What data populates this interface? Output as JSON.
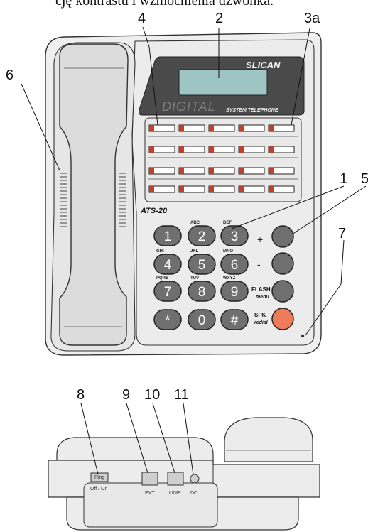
{
  "header_text": "cję kontrastu i wzmocnienia dzwonka.",
  "callouts": {
    "c1": "1",
    "c2": "2",
    "c3a": "3a",
    "c4": "4",
    "c5": "5",
    "c6": "6",
    "c7": "7",
    "c8": "8",
    "c9": "9",
    "c10": "10",
    "c11": "11"
  },
  "phone": {
    "brand": "SLICAN",
    "digital": "DIGITAL",
    "system_label": "SYSTEM TELEPHONE",
    "model": "ATS-20"
  },
  "keypad": {
    "digits": [
      "1",
      "2",
      "3",
      "4",
      "5",
      "6",
      "7",
      "8",
      "9",
      "*",
      "0",
      "#"
    ],
    "letters": [
      "",
      "ABC",
      "DEF",
      "GHI",
      "JKL",
      "MNO",
      "PQRS",
      "TUV",
      "WXYZ",
      "",
      "",
      ""
    ]
  },
  "function_keys": {
    "plus": "+",
    "minus": "-",
    "flash": "FLASH",
    "flash_sub": "menu",
    "spk": "SPK",
    "spk_sub": "redial"
  },
  "back_panel": {
    "ring_label": "Ring",
    "ring_switch": "Off / On",
    "ext": "EXT",
    "line": "LINE",
    "dc": "DC"
  },
  "colors": {
    "body": "#efefef",
    "outline": "#333333",
    "display_bezel": "#4a4a4a",
    "lcd": "#9fc4c4",
    "key_gray": "#6f6f6f",
    "led_red": "#c0402b",
    "spk_orange": "#ee7b5a"
  }
}
